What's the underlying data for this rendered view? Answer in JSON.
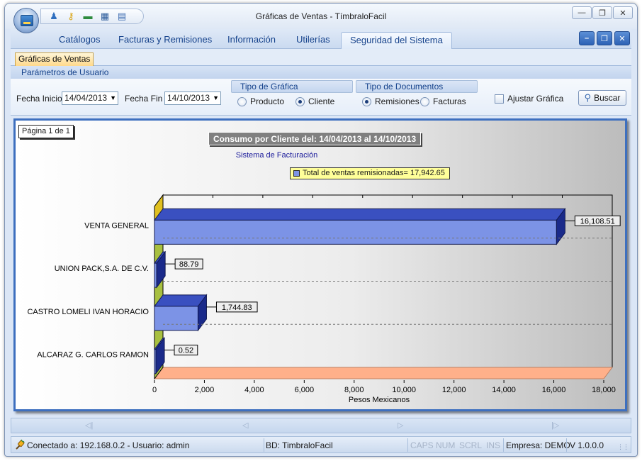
{
  "window": {
    "title": "Gráficas de Ventas - TímbraloFacil",
    "controls": {
      "minimize": "—",
      "restore": "❐",
      "close": "✕"
    }
  },
  "quick_access": {
    "icons": [
      "users-icon",
      "key-icon",
      "money-icon",
      "calculator-icon",
      "document-icon"
    ]
  },
  "menu": {
    "tabs": [
      "Catálogos",
      "Facturas y Remisiones",
      "Información",
      "Utilerías",
      "Seguridad del Sistema"
    ],
    "active_index": 4,
    "mdi": {
      "minimize": "–",
      "restore": "❐",
      "close": "✕"
    }
  },
  "doc_tab": {
    "label": "Gráficas de Ventas"
  },
  "params": {
    "header": "Parámetros de Usuario",
    "fecha_inicio_label": "Fecha Inicio",
    "fecha_inicio_value": "14/04/2013",
    "fecha_fin_label": "Fecha Fin",
    "fecha_fin_value": "14/10/2013",
    "tipo_grafica": {
      "label": "Tipo de Gráfica",
      "options": [
        "Producto",
        "Cliente"
      ],
      "selected": "Cliente"
    },
    "tipo_documentos": {
      "label": "Tipo de Documentos",
      "options": [
        "Remisiones",
        "Facturas"
      ],
      "selected": "Remisiones"
    },
    "ajustar_label": "Ajustar Gráfica",
    "ajustar_checked": false,
    "buscar_label": "Buscar"
  },
  "chart_panel": {
    "page_label": "Página 1 de 1"
  },
  "chart_data": {
    "type": "bar",
    "orientation": "horizontal",
    "style": "3d",
    "title": "Consumo por Cliente del: 14/04/2013 al 14/10/2013",
    "subtitle": "Sistema de Facturación",
    "legend": "Total de ventas remisionadas= 17,942.65",
    "xlabel": "Pesos Mexicanos",
    "ylabel": "",
    "categories": [
      "VENTA GENERAL",
      "UNION PACK,S.A. DE C.V.",
      "CASTRO LOMELI IVAN HORACIO",
      "ALCARAZ G. CARLOS RAMON"
    ],
    "values": [
      16108.51,
      88.79,
      1744.83,
      0.52
    ],
    "value_labels": [
      "16,108.51",
      "88.79",
      "1,744.83",
      "0.52"
    ],
    "xlim": [
      0,
      18000
    ],
    "xticks": [
      "0",
      "2,000",
      "4,000",
      "6,000",
      "8,000",
      "10,000",
      "12,000",
      "14,000",
      "16,000",
      "18,000"
    ],
    "grid": true,
    "colors": {
      "bar_front": "#7c93e6",
      "bar_top": "#3a50c0",
      "bar_side": "#1a2a8a",
      "wall": "#a8c040",
      "wall_top": "#e0c020",
      "floor": "#ffb08a"
    }
  },
  "navigator": {
    "first": "◁|",
    "prev": "◁",
    "next": "▷",
    "last": "|▷"
  },
  "status": {
    "connection": "Conectado a: 192.168.0.2 - Usuario: admin",
    "db": "BD: TimbraloFacil",
    "caps": "CAPS",
    "num": "NUM",
    "scrl": "SCRL",
    "ins": "INS",
    "empresa": "Empresa: DEMO",
    "version": "V 1.0.0.0"
  }
}
